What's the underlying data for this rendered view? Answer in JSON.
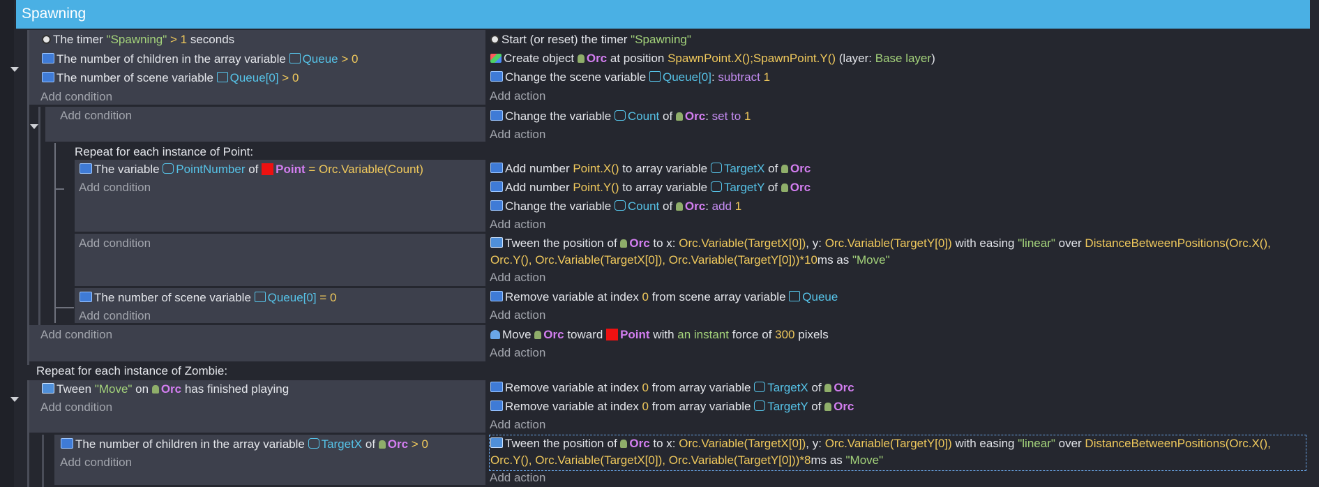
{
  "group": {
    "title": "Spawning"
  },
  "common": {
    "add_condition": "Add condition",
    "add_action": "Add action"
  },
  "e1": {
    "conditions": [
      {
        "pre": "The timer ",
        "name": "\"Spawning\"",
        "mid": " > ",
        "val": "1",
        "post": " seconds"
      },
      {
        "pre": "The number of children in the array variable ",
        "name": "Queue",
        "mid": " > ",
        "val": "0"
      },
      {
        "pre": "The number of scene variable ",
        "name": "Queue[0]",
        "mid": " > ",
        "val": "0"
      }
    ],
    "actions": [
      {
        "pre": "Start (or reset) the timer ",
        "name": "\"Spawning\""
      },
      {
        "pre": "Create object ",
        "obj": "Orc",
        "mid": " at position ",
        "expr": "SpawnPoint.X();SpawnPoint.Y()",
        "post1": " (layer: ",
        "layer": "Base layer",
        "post2": ")"
      },
      {
        "pre": "Change the scene variable ",
        "name": "Queue[0]",
        "sep": ": ",
        "op": "subtract",
        "val": "1"
      }
    ]
  },
  "e2": {
    "actions": [
      {
        "pre": "Change the variable ",
        "name": "Count",
        "of": " of ",
        "obj": "Orc",
        "sep": ": ",
        "op": "set to",
        "val": "1"
      }
    ]
  },
  "e3": {
    "repeat": "Repeat for each instance of Point:",
    "condition": {
      "pre": "The variable ",
      "name": "PointNumber",
      "of": " of ",
      "obj": "Point",
      "mid": " = ",
      "expr": "Orc.Variable(Count)"
    },
    "actions": [
      {
        "pre": "Add number ",
        "expr": "Point.X()",
        "mid": " to array variable ",
        "name": "TargetX",
        "of": " of ",
        "obj": "Orc"
      },
      {
        "pre": "Add number ",
        "expr": "Point.Y()",
        "mid": " to array variable ",
        "name": "TargetY",
        "of": " of ",
        "obj": "Orc"
      },
      {
        "pre": "Change the variable ",
        "name": "Count",
        "of": " of ",
        "obj": "Orc",
        "sep": ": ",
        "op": "add",
        "val": "1"
      }
    ]
  },
  "e4": {
    "tween": {
      "pre": "Tween the position of ",
      "obj": "Orc",
      "tox": " to x: ",
      "x": "Orc.Variable(TargetX[0])",
      "ty": ", y: ",
      "y": "Orc.Variable(TargetY[0])",
      "ease": " with easing ",
      "easing": "\"linear\"",
      "over": " over ",
      "expr1": "DistanceBetweenPositions(Orc.X(),",
      "expr2": "Orc.Y(), Orc.Variable(TargetX[0]), Orc.Variable(TargetY[0]))*10",
      "as": "ms as ",
      "id": "\"Move\""
    }
  },
  "e5": {
    "condition": {
      "pre": "The number of scene variable ",
      "name": "Queue[0]",
      "mid": " = ",
      "val": "0"
    },
    "action": {
      "pre": "Remove variable at index ",
      "idx": "0",
      "mid": " from scene array variable ",
      "name": "Queue"
    }
  },
  "e6": {
    "action": {
      "pre": "Move ",
      "obj": "Orc",
      "mid": " toward ",
      "target": "Point",
      "with": " with ",
      "kind": "an instant",
      "force": " force of ",
      "val": "300",
      "post": " pixels"
    }
  },
  "e7": {
    "repeat": "Repeat for each instance of Zombie:",
    "condition": {
      "pre": "Tween ",
      "id": "\"Move\"",
      "on": " on ",
      "obj": "Orc",
      "post": " has finished playing"
    },
    "actions": [
      {
        "pre": "Remove variable at index ",
        "idx": "0",
        "mid": " from array variable ",
        "name": "TargetX",
        "of": " of ",
        "obj": "Orc"
      },
      {
        "pre": "Remove variable at index ",
        "idx": "0",
        "mid": " from array variable ",
        "name": "TargetY",
        "of": " of ",
        "obj": "Orc"
      }
    ]
  },
  "e8": {
    "condition": {
      "pre": "The number of children in the array variable ",
      "name": "TargetX",
      "of": " of ",
      "obj": "Orc",
      "mid": " > ",
      "val": "0"
    },
    "tween": {
      "pre": "Tween the position of ",
      "obj": "Orc",
      "tox": " to x: ",
      "x": "Orc.Variable(TargetX[0])",
      "ty": ", y: ",
      "y": "Orc.Variable(TargetY[0])",
      "ease": " with easing ",
      "easing": "\"linear\"",
      "over": " over ",
      "expr1": "DistanceBetweenPositions(Orc.X(),",
      "expr2": "Orc.Y(), Orc.Variable(TargetX[0]), Orc.Variable(TargetY[0]))*8",
      "as": "ms as ",
      "id": "\"Move\""
    }
  }
}
